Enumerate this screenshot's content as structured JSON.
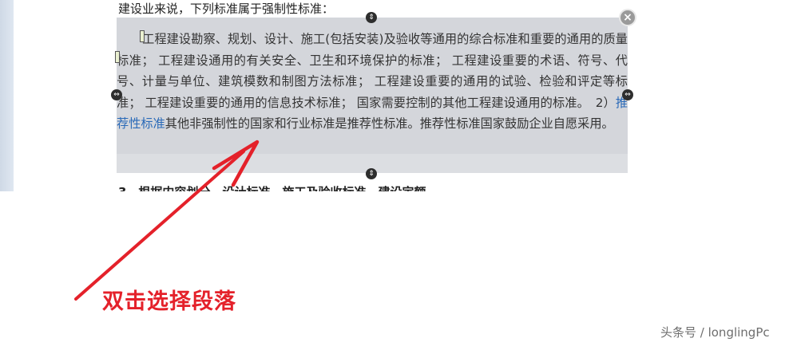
{
  "document": {
    "preceding_line": "建设业来说，下列标准属于强制性标准：",
    "paragraph": {
      "text_before_link": "工程建设勘察、规划、设计、施工(包括安装)及验收等通用的综合标准和重要的通用的质量标准； 工程建设通用的有关安全、卫生和环境保护的标准； 工程建设重要的术语、符号、代号、计量与单位、建筑模数和制图方法标准； 工程建设重要的通用的试验、检验和评定等标准； 工程建设重要的通用的信息技术标准； 国家需要控制的其他工程建设通用的标准。　2）",
      "link_text": "推荐性标准",
      "text_after_link": "其他非强制性的国家和行业标准是推荐性标准。推荐性标准国家鼓励企业自愿采用。"
    },
    "next_line_partial": "3、根据内容划分，设计标准、施工及验收标准、建设定额"
  },
  "controls": {
    "close_symbol": "×",
    "handle_vertical_symbol": "⇕",
    "handle_horizontal_symbol": "⇔"
  },
  "annotation": {
    "caption": "双击选择段落",
    "arrow_color": "#e4212a"
  },
  "watermark": "头条号 / longlingPc",
  "colors": {
    "selection": "#d4d6db",
    "link": "#2a6ab8",
    "caption": "#e4212a"
  }
}
